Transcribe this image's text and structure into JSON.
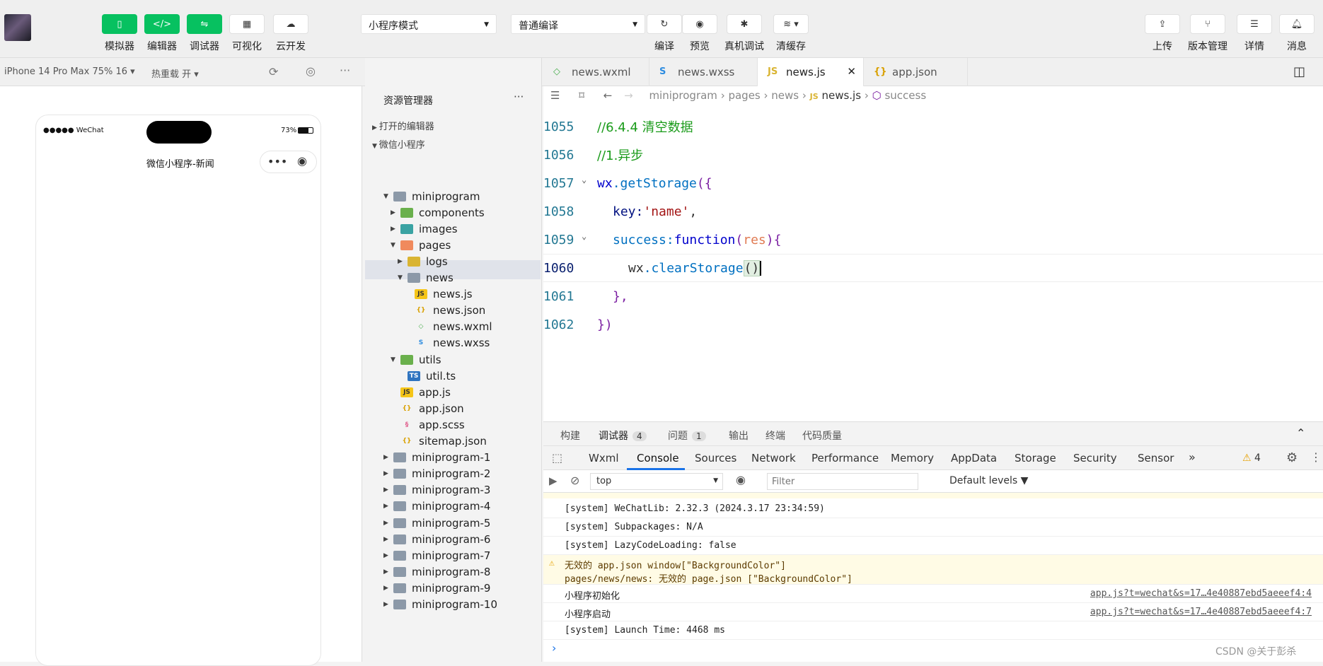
{
  "toolbar": {
    "left_buttons": [
      {
        "label": "模拟器",
        "icon": "phone-icon"
      },
      {
        "label": "编辑器",
        "icon": "code-icon"
      },
      {
        "label": "调试器",
        "icon": "debug-icon"
      },
      {
        "label": "可视化",
        "icon": "layout-icon"
      },
      {
        "label": "云开发",
        "icon": "cloud-icon"
      }
    ],
    "mode_select": "小程序模式",
    "compile_select": "普通编译",
    "mid_buttons": [
      {
        "label": "编译",
        "icon": "refresh-icon"
      },
      {
        "label": "预览",
        "icon": "eye-icon"
      },
      {
        "label": "真机调试",
        "icon": "bug-icon"
      },
      {
        "label": "清缓存",
        "icon": "layers-icon"
      }
    ],
    "right_buttons": [
      {
        "label": "上传",
        "icon": "upload-icon"
      },
      {
        "label": "版本管理",
        "icon": "branch-icon"
      },
      {
        "label": "详情",
        "icon": "menu-icon"
      },
      {
        "label": "消息",
        "icon": "bell-icon"
      }
    ]
  },
  "subbar": {
    "device": "iPhone 14 Pro Max 75% 16 ▾",
    "hot_reload": "热重载 开 ▾",
    "tabs": [
      {
        "label": "news.wxml",
        "icon": "wxml-file-icon"
      },
      {
        "label": "news.wxss",
        "icon": "wxss-file-icon"
      },
      {
        "label": "news.js",
        "icon": "js-file-icon"
      },
      {
        "label": "app.json",
        "icon": "json-file-icon"
      }
    ]
  },
  "simulator": {
    "status_left": "●●●●● WeChat",
    "battery": "73%",
    "page_title": "微信小程序-新闻"
  },
  "explorer": {
    "title": "资源管理器",
    "more": "···",
    "open_editors": "打开的编辑器",
    "project": "微信小程序",
    "tree": [
      {
        "label": "miniprogram",
        "kind": "folder"
      },
      {
        "label": "components",
        "kind": "folder-green"
      },
      {
        "label": "images",
        "kind": "folder-cyan"
      },
      {
        "label": "pages",
        "kind": "folder-orange"
      },
      {
        "label": "logs",
        "kind": "folder-yellow"
      },
      {
        "label": "news",
        "kind": "folder"
      },
      {
        "label": "news.js",
        "kind": "js"
      },
      {
        "label": "news.json",
        "kind": "json"
      },
      {
        "label": "news.wxml",
        "kind": "wxml"
      },
      {
        "label": "news.wxss",
        "kind": "wxss"
      },
      {
        "label": "utils",
        "kind": "folder-green"
      },
      {
        "label": "util.ts",
        "kind": "ts"
      },
      {
        "label": "app.js",
        "kind": "js"
      },
      {
        "label": "app.json",
        "kind": "json"
      },
      {
        "label": "app.scss",
        "kind": "scss"
      },
      {
        "label": "sitemap.json",
        "kind": "json"
      },
      {
        "label": "miniprogram-1",
        "kind": "folder"
      },
      {
        "label": "miniprogram-2",
        "kind": "folder"
      },
      {
        "label": "miniprogram-3",
        "kind": "folder"
      },
      {
        "label": "miniprogram-4",
        "kind": "folder"
      },
      {
        "label": "miniprogram-5",
        "kind": "folder"
      },
      {
        "label": "miniprogram-6",
        "kind": "folder"
      },
      {
        "label": "miniprogram-7",
        "kind": "folder"
      },
      {
        "label": "miniprogram-8",
        "kind": "folder"
      },
      {
        "label": "miniprogram-9",
        "kind": "folder"
      },
      {
        "label": "miniprogram-10",
        "kind": "folder"
      }
    ]
  },
  "editor": {
    "breadcrumb": [
      "miniprogram",
      "pages",
      "news",
      "news.js",
      "success"
    ],
    "lines": [
      {
        "n": "1055",
        "text": "//6.4.4 清空数据"
      },
      {
        "n": "1056",
        "text": "//1.异步"
      },
      {
        "n": "1057",
        "a": "wx",
        "b": ".getStorage",
        "c": "({"
      },
      {
        "n": "1058",
        "a": "key:",
        "b": "'name'",
        "c": ","
      },
      {
        "n": "1059",
        "a": "success:",
        "b": "function",
        "c": "(",
        "d": "res",
        "e": "){"
      },
      {
        "n": "1060",
        "a": "wx",
        "b": ".clearStorage",
        "c": "()"
      },
      {
        "n": "1061",
        "a": "},"
      },
      {
        "n": "1062",
        "a": "})"
      }
    ]
  },
  "panel": {
    "tabs": [
      {
        "label": "构建"
      },
      {
        "label": "调试器",
        "badge": "4"
      },
      {
        "label": "问题",
        "badge": "1"
      },
      {
        "label": "输出"
      },
      {
        "label": "终端"
      },
      {
        "label": "代码质量"
      }
    ],
    "devtools_tabs": [
      "Wxml",
      "Console",
      "Sources",
      "Network",
      "Performance",
      "Memory",
      "AppData",
      "Storage",
      "Security",
      "Sensor"
    ],
    "warn_count": "4",
    "context": "top",
    "filter_placeholder": "Filter",
    "levels": "Default levels ▼",
    "logs": [
      {
        "text": "[system] WeChatLib: 2.32.3 (2024.3.17 23:34:59)"
      },
      {
        "text": "[system] Subpackages: N/A"
      },
      {
        "text": "[system] LazyCodeLoading: false"
      },
      {
        "text": "无效的 app.json window[\"BackgroundColor\"]",
        "text2": "pages/news/news: 无效的 page.json [\"BackgroundColor\"]"
      },
      {
        "text": "小程序初始化",
        "link": "app.js?t=wechat&s=17…4e40887ebd5aeeef4:4"
      },
      {
        "text": "小程序启动",
        "link": "app.js?t=wechat&s=17…4e40887ebd5aeeef4:7"
      },
      {
        "text": "[system] Launch Time: 4468 ms"
      }
    ],
    "prompt": "›"
  },
  "watermark": "CSDN @关于彭杀",
  "colors": {
    "accent": "#07c160",
    "warn_bg": "#fffbe5",
    "link": "#237893"
  }
}
